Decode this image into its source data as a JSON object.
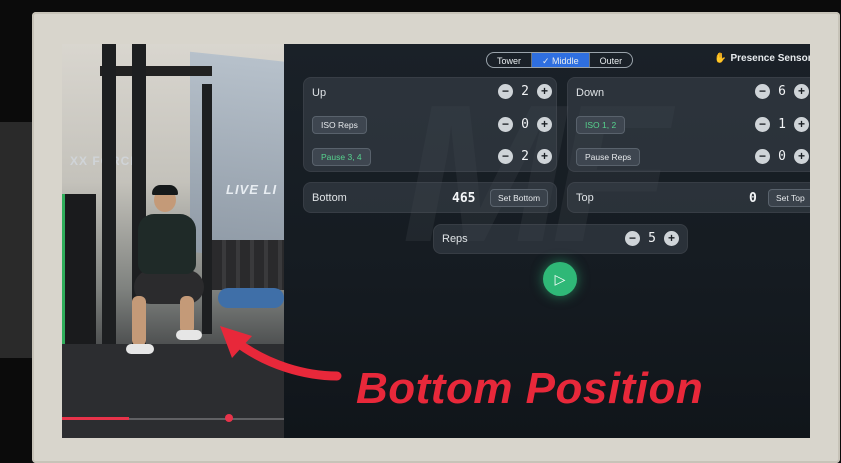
{
  "video": {
    "banner_text": "LIVE LI",
    "banner_subtext": "XX FORCE",
    "progress_fraction": 0.3
  },
  "app": {
    "watermark": "MF",
    "mode_selector": {
      "options": [
        "Tower",
        "✓ Middle",
        "Outer"
      ],
      "selected": "Middle"
    },
    "presence_sensor_label": "Presence Sensor",
    "up_card": {
      "title": "Up",
      "value": "2",
      "rows": [
        {
          "chip": "ISO Reps",
          "value": "0",
          "chip_color": "white"
        },
        {
          "chip": "Pause 3, 4",
          "value": "2",
          "chip_color": "green"
        }
      ]
    },
    "down_card": {
      "title": "Down",
      "value": "6",
      "rows": [
        {
          "chip": "ISO 1, 2",
          "value": "1",
          "chip_color": "green"
        },
        {
          "chip": "Pause Reps",
          "value": "0",
          "chip_color": "white"
        }
      ]
    },
    "bottom_card": {
      "title": "Bottom",
      "value": "46.5",
      "display": "465",
      "button": "Set Bottom"
    },
    "top_card": {
      "title": "Top",
      "value": "0",
      "button": "Set Top"
    },
    "reps_card": {
      "title": "Reps",
      "value": "5"
    },
    "stepper_minus": "−",
    "stepper_plus": "+",
    "play_icon": "▷"
  },
  "annotation": {
    "caption": "Bottom Position",
    "color": "#e8283a"
  },
  "colors": {
    "accent_blue": "#2f6fe0",
    "accent_green": "#2fb877",
    "red": "#e8283a"
  }
}
